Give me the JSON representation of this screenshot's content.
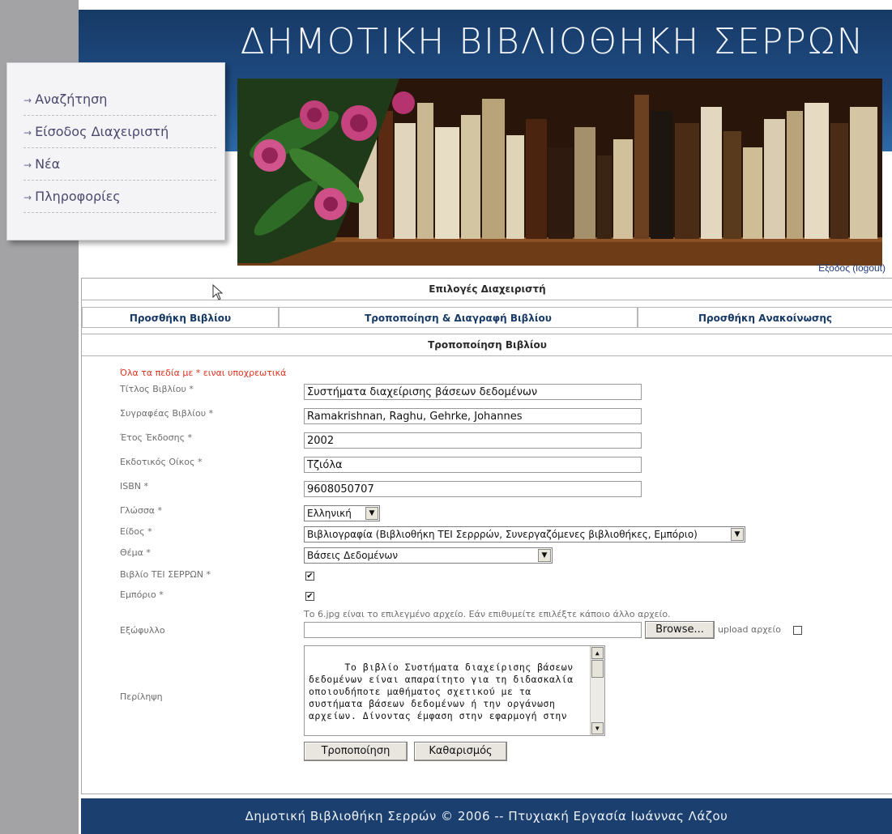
{
  "site": {
    "title": "ΔΗΜΟΤΙΚΗ ΒΙΒΛΙΟΘΗΚΗ ΣΕΡΡΩΝ",
    "brand_color": "#1b3f6e",
    "accent_color": "#e0321f"
  },
  "menu": {
    "items": [
      {
        "label": "Αναζήτηση",
        "icon": "arrow-right-icon"
      },
      {
        "label": "Είσοδος Διαχειριστή",
        "icon": "arrow-right-icon"
      },
      {
        "label": "Νέα",
        "icon": "arrow-right-icon"
      },
      {
        "label": "Πληροφορίες",
        "icon": "arrow-right-icon"
      }
    ],
    "arrow": "→"
  },
  "header": {
    "logout_label": "Έξοδος (logout)"
  },
  "admin": {
    "section_title": "Επιλογές Διαχειριστή",
    "tabs": [
      {
        "label": "Προσθήκη Βιβλίου"
      },
      {
        "label": "Τροποποίηση & Διαγραφή Βιβλίου"
      },
      {
        "label": "Προσθήκη Ανακοίνωσης"
      }
    ],
    "form_title": "Τροποποίηση Βιβλίου"
  },
  "form": {
    "required_note": "Όλα τα πεδία με * ειναι υποχρεωτικά",
    "fields": {
      "title": {
        "label": "Τίτλος Βιβλίου *",
        "value": "Συστήματα διαχείρισης βάσεων δεδομένων"
      },
      "author": {
        "label": "Συγραφέας Βιβλίου *",
        "value": "Ramakrishnan, Raghu, Gehrke, Johannes"
      },
      "year": {
        "label": "Έτος Έκδοσης *",
        "value": "2002"
      },
      "publisher": {
        "label": "Εκδοτικός Οίκος *",
        "value": "Τζιόλα"
      },
      "isbn": {
        "label": "ISBN *",
        "value": "9608050707"
      },
      "language": {
        "label": "Γλώσσα *",
        "value": "Ελληνική"
      },
      "type": {
        "label": "Είδος *",
        "value": "Βιβλιογραφία (Βιβλιοθήκη ΤΕΙ Σερρρών, Συνεργαζόμενες βιβλιοθήκες, Εμπόριο)"
      },
      "subject": {
        "label": "Θέμα *",
        "value": "Βάσεις Δεδομένων"
      },
      "tei_book": {
        "label": "Βιβλίο ΤΕΙ ΣΕΡΡΩΝ *",
        "checked": true
      },
      "commerce": {
        "label": "Εμπόριο *",
        "checked": true
      },
      "cover": {
        "label": "Εξώφυλλο",
        "note": "Το 6.jpg είναι το επιλεγμένο αρχείο. Εάν επιθυμείτε επιλέξτε κάποιο άλλο αρχείο.",
        "value": "",
        "browse_label": "Browse...",
        "upload_label": "upload αρχείο",
        "upload_checked": false
      },
      "summary": {
        "label": "Περίληψη",
        "value": "Το βιβλίο Συστήματα διαχείρισης βάσεων δεδομένων είναι απαραίτητο για τη διδασκαλία οποιουδήποτε μαθήματος σχετικού με τα συστήματα βάσεων δεδομένων ή την οργάνωση αρχείων. Δίνοντας έμφαση στην εφαρμογή στην"
      }
    },
    "submit_label": "Τροποποίηση",
    "reset_label": "Καθαρισμός"
  },
  "footer": {
    "text": "Δημοτική Βιβλιοθήκη Σερρών © 2006 -- Πτυχιακή Εργασία Ιωάννας Λάζου"
  }
}
